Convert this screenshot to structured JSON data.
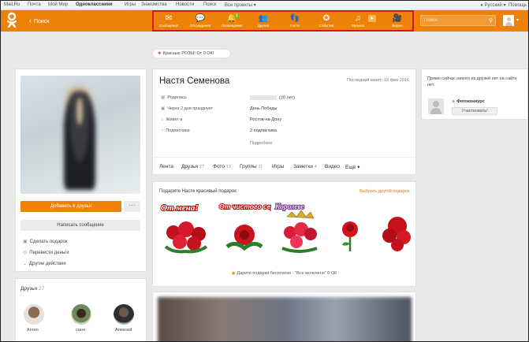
{
  "portal": {
    "links": [
      "Mail.Ru",
      "Почта",
      "Мой Мир",
      "Одноклассники",
      "Игры",
      "Знакомства",
      "Новости",
      "Поиск",
      "Все проекты ▾"
    ],
    "language": "Русский ▾",
    "help": "Помощь"
  },
  "header": {
    "back_label": "Поиск",
    "nav": [
      {
        "label": "Сообщения",
        "icon": "envelope-icon"
      },
      {
        "label": "Обсуждения",
        "icon": "chat-bubbles-icon"
      },
      {
        "label": "Оповещения",
        "icon": "bell-icon",
        "badge": "1"
      },
      {
        "label": "Друзья",
        "icon": "people-icon"
      },
      {
        "label": "Гости",
        "icon": "footprints-icon"
      },
      {
        "label": "События",
        "icon": "events-icon"
      },
      {
        "label": "Музыка",
        "icon": "music-note-icon"
      },
      {
        "label": "Видео",
        "icon": "video-camera-icon"
      }
    ],
    "search_placeholder": "Поиск",
    "accent_color": "#ee8208",
    "highlight_color": "#d8141e"
  },
  "promo": {
    "text": "Красные РОЗЫ! От 0 ОК!"
  },
  "profile": {
    "name": "Настя Семенова",
    "last_visit": "Последний визит: 16 фев 2016",
    "info": [
      {
        "label": "Родилась",
        "icon": "calendar-icon",
        "value": "(20 лет)"
      },
      {
        "label": "Через 2 дня празднует",
        "icon": "gift-icon",
        "value": "День Победы"
      },
      {
        "label": "Живет в",
        "icon": "home-icon",
        "value": "Ростов-на-Дону"
      },
      {
        "label": "Подписчики",
        "icon": "rss-icon",
        "value": "2 подписчика"
      }
    ],
    "more": "Подробнее",
    "tabs": [
      {
        "label": "Лента",
        "count": ""
      },
      {
        "label": "Друзья",
        "count": "27"
      },
      {
        "label": "Фото",
        "count": "13"
      },
      {
        "label": "Группы",
        "count": "11"
      },
      {
        "label": "Игры",
        "count": ""
      },
      {
        "label": "Заметки",
        "count": "4"
      },
      {
        "label": "Видео",
        "count": ""
      },
      {
        "label": "Ещё ▾",
        "count": ""
      }
    ]
  },
  "left": {
    "add_friend": "Добавить в друзья",
    "more_btn": "···",
    "write_message": "Написать сообщение",
    "actions": [
      {
        "label": "Сделать подарок",
        "icon": "gift-icon"
      },
      {
        "label": "Перевести деньги",
        "icon": "money-icon"
      },
      {
        "label": "Другие действия",
        "icon": "chevron-down-icon"
      }
    ],
    "friends_title": "Друзья",
    "friends_count": "27",
    "friends": [
      {
        "name": "Ангел"
      },
      {
        "name": "саня"
      },
      {
        "name": "Алексей"
      }
    ]
  },
  "gifts": {
    "title": "Подарите Насте красивый подарок",
    "choose_link": "Выбрать другой подарок",
    "captions": [
      "От мена!",
      "От чистого сердца",
      "Королеве"
    ],
    "free_text": "Дарите подарки бесплатно - \"Все включено\" 0 ОК"
  },
  "right": {
    "online_text": "Прямо сейчас никого из друзей нет на сайте нет.",
    "contest_name": "Фотоконкурс",
    "participate": "Участвовать!"
  }
}
